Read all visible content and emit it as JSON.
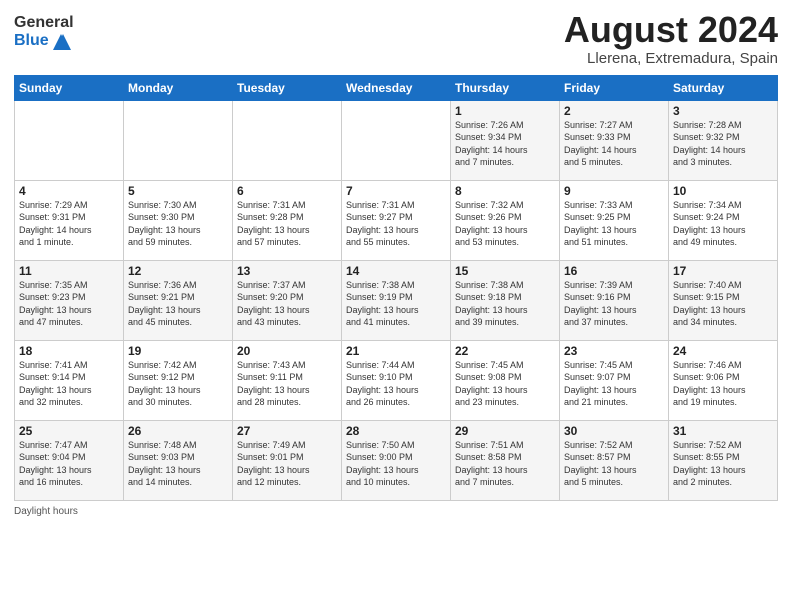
{
  "header": {
    "logo_general": "General",
    "logo_blue": "Blue",
    "month_year": "August 2024",
    "location": "Llerena, Extremadura, Spain"
  },
  "days_of_week": [
    "Sunday",
    "Monday",
    "Tuesday",
    "Wednesday",
    "Thursday",
    "Friday",
    "Saturday"
  ],
  "weeks": [
    [
      {
        "day": "",
        "info": ""
      },
      {
        "day": "",
        "info": ""
      },
      {
        "day": "",
        "info": ""
      },
      {
        "day": "",
        "info": ""
      },
      {
        "day": "1",
        "info": "Sunrise: 7:26 AM\nSunset: 9:34 PM\nDaylight: 14 hours\nand 7 minutes."
      },
      {
        "day": "2",
        "info": "Sunrise: 7:27 AM\nSunset: 9:33 PM\nDaylight: 14 hours\nand 5 minutes."
      },
      {
        "day": "3",
        "info": "Sunrise: 7:28 AM\nSunset: 9:32 PM\nDaylight: 14 hours\nand 3 minutes."
      }
    ],
    [
      {
        "day": "4",
        "info": "Sunrise: 7:29 AM\nSunset: 9:31 PM\nDaylight: 14 hours\nand 1 minute."
      },
      {
        "day": "5",
        "info": "Sunrise: 7:30 AM\nSunset: 9:30 PM\nDaylight: 13 hours\nand 59 minutes."
      },
      {
        "day": "6",
        "info": "Sunrise: 7:31 AM\nSunset: 9:28 PM\nDaylight: 13 hours\nand 57 minutes."
      },
      {
        "day": "7",
        "info": "Sunrise: 7:31 AM\nSunset: 9:27 PM\nDaylight: 13 hours\nand 55 minutes."
      },
      {
        "day": "8",
        "info": "Sunrise: 7:32 AM\nSunset: 9:26 PM\nDaylight: 13 hours\nand 53 minutes."
      },
      {
        "day": "9",
        "info": "Sunrise: 7:33 AM\nSunset: 9:25 PM\nDaylight: 13 hours\nand 51 minutes."
      },
      {
        "day": "10",
        "info": "Sunrise: 7:34 AM\nSunset: 9:24 PM\nDaylight: 13 hours\nand 49 minutes."
      }
    ],
    [
      {
        "day": "11",
        "info": "Sunrise: 7:35 AM\nSunset: 9:23 PM\nDaylight: 13 hours\nand 47 minutes."
      },
      {
        "day": "12",
        "info": "Sunrise: 7:36 AM\nSunset: 9:21 PM\nDaylight: 13 hours\nand 45 minutes."
      },
      {
        "day": "13",
        "info": "Sunrise: 7:37 AM\nSunset: 9:20 PM\nDaylight: 13 hours\nand 43 minutes."
      },
      {
        "day": "14",
        "info": "Sunrise: 7:38 AM\nSunset: 9:19 PM\nDaylight: 13 hours\nand 41 minutes."
      },
      {
        "day": "15",
        "info": "Sunrise: 7:38 AM\nSunset: 9:18 PM\nDaylight: 13 hours\nand 39 minutes."
      },
      {
        "day": "16",
        "info": "Sunrise: 7:39 AM\nSunset: 9:16 PM\nDaylight: 13 hours\nand 37 minutes."
      },
      {
        "day": "17",
        "info": "Sunrise: 7:40 AM\nSunset: 9:15 PM\nDaylight: 13 hours\nand 34 minutes."
      }
    ],
    [
      {
        "day": "18",
        "info": "Sunrise: 7:41 AM\nSunset: 9:14 PM\nDaylight: 13 hours\nand 32 minutes."
      },
      {
        "day": "19",
        "info": "Sunrise: 7:42 AM\nSunset: 9:12 PM\nDaylight: 13 hours\nand 30 minutes."
      },
      {
        "day": "20",
        "info": "Sunrise: 7:43 AM\nSunset: 9:11 PM\nDaylight: 13 hours\nand 28 minutes."
      },
      {
        "day": "21",
        "info": "Sunrise: 7:44 AM\nSunset: 9:10 PM\nDaylight: 13 hours\nand 26 minutes."
      },
      {
        "day": "22",
        "info": "Sunrise: 7:45 AM\nSunset: 9:08 PM\nDaylight: 13 hours\nand 23 minutes."
      },
      {
        "day": "23",
        "info": "Sunrise: 7:45 AM\nSunset: 9:07 PM\nDaylight: 13 hours\nand 21 minutes."
      },
      {
        "day": "24",
        "info": "Sunrise: 7:46 AM\nSunset: 9:06 PM\nDaylight: 13 hours\nand 19 minutes."
      }
    ],
    [
      {
        "day": "25",
        "info": "Sunrise: 7:47 AM\nSunset: 9:04 PM\nDaylight: 13 hours\nand 16 minutes."
      },
      {
        "day": "26",
        "info": "Sunrise: 7:48 AM\nSunset: 9:03 PM\nDaylight: 13 hours\nand 14 minutes."
      },
      {
        "day": "27",
        "info": "Sunrise: 7:49 AM\nSunset: 9:01 PM\nDaylight: 13 hours\nand 12 minutes."
      },
      {
        "day": "28",
        "info": "Sunrise: 7:50 AM\nSunset: 9:00 PM\nDaylight: 13 hours\nand 10 minutes."
      },
      {
        "day": "29",
        "info": "Sunrise: 7:51 AM\nSunset: 8:58 PM\nDaylight: 13 hours\nand 7 minutes."
      },
      {
        "day": "30",
        "info": "Sunrise: 7:52 AM\nSunset: 8:57 PM\nDaylight: 13 hours\nand 5 minutes."
      },
      {
        "day": "31",
        "info": "Sunrise: 7:52 AM\nSunset: 8:55 PM\nDaylight: 13 hours\nand 2 minutes."
      }
    ]
  ],
  "footer": {
    "daylight_hours_label": "Daylight hours"
  }
}
